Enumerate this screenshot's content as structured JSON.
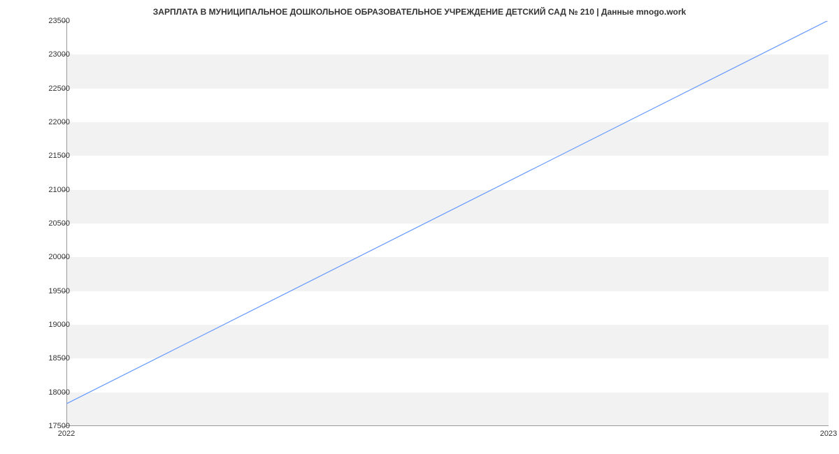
{
  "chart_data": {
    "type": "line",
    "title": "ЗАРПЛАТА В МУНИЦИПАЛЬНОЕ ДОШКОЛЬНОЕ ОБРАЗОВАТЕЛЬНОЕ УЧРЕЖДЕНИЕ ДЕТСКИЙ САД № 210 | Данные mnogo.work",
    "x": [
      "2022",
      "2023"
    ],
    "values": [
      17830,
      23510
    ],
    "xlabel": "",
    "ylabel": "",
    "ylim": [
      17500,
      23500
    ],
    "y_ticks": [
      17500,
      18000,
      18500,
      19000,
      19500,
      20000,
      20500,
      21000,
      21500,
      22000,
      22500,
      23000,
      23500
    ],
    "line_color": "#6699ff"
  }
}
